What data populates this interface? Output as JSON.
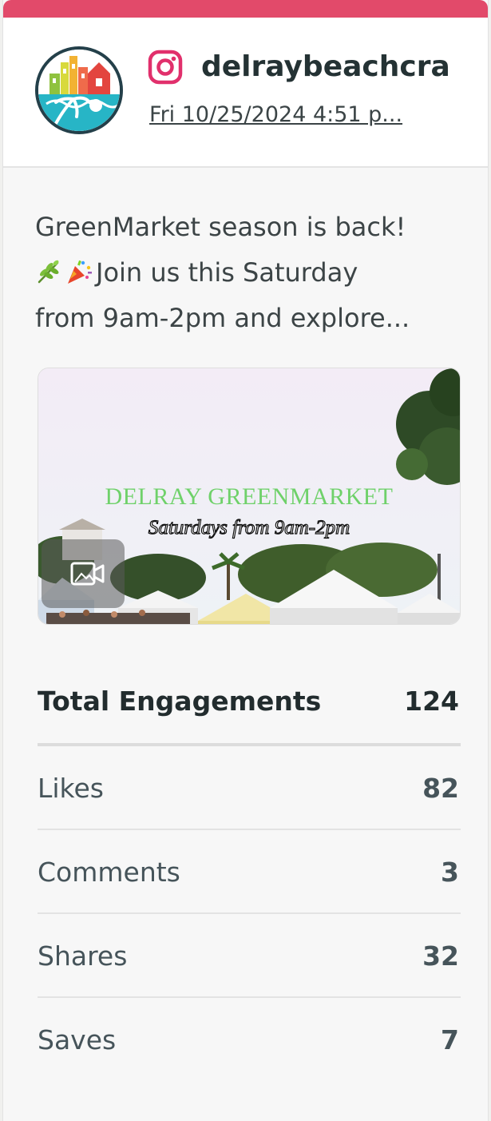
{
  "colors": {
    "accent": "#e24a6a",
    "instagram": "#e1306c",
    "text_dark": "#222c2e",
    "text_muted": "#46545a"
  },
  "post": {
    "account_handle": "delraybeachcra",
    "platform_icon": "instagram-icon",
    "timestamp": "Fri 10/25/2024 4:51 p...",
    "caption_lines": [
      "GreenMarket season is back!",
      "Join us this Saturday",
      "from 9am-2pm and explore..."
    ],
    "caption_emojis": [
      "herb-emoji",
      "party-popper-emoji"
    ]
  },
  "media": {
    "type_icon": "video-camera-icon",
    "overlay_title": "DELRAY GREENMARKET",
    "overlay_subtitle": "Saturdays from 9am-2pm"
  },
  "stats": {
    "total": {
      "label": "Total Engagements",
      "value": "124"
    },
    "items": [
      {
        "label": "Likes",
        "value": "82"
      },
      {
        "label": "Comments",
        "value": "3"
      },
      {
        "label": "Shares",
        "value": "32"
      },
      {
        "label": "Saves",
        "value": "7"
      }
    ]
  }
}
